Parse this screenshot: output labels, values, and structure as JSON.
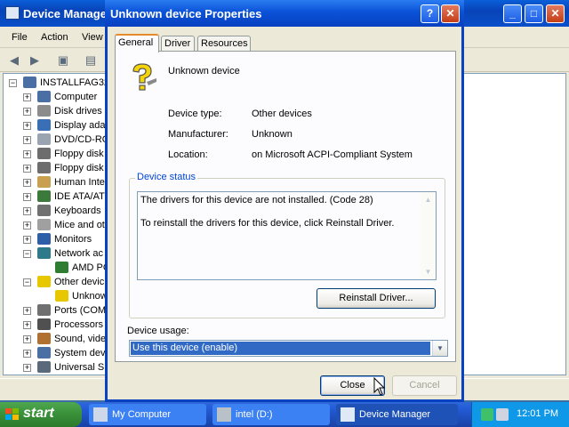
{
  "device_manager": {
    "title": "Device Manager",
    "menu": [
      "File",
      "Action",
      "View"
    ],
    "tree": [
      {
        "label": "INSTALLFAG32",
        "level": 0,
        "expander": "minus",
        "icon": "computer-icon"
      },
      {
        "label": "Computer",
        "level": 1,
        "expander": "plus",
        "icon": "computer-icon"
      },
      {
        "label": "Disk drives",
        "level": 1,
        "expander": "plus",
        "icon": "disk-drive-icon"
      },
      {
        "label": "Display ada",
        "level": 1,
        "expander": "plus",
        "icon": "display-adapter-icon"
      },
      {
        "label": "DVD/CD-RO",
        "level": 1,
        "expander": "plus",
        "icon": "cdrom-icon"
      },
      {
        "label": "Floppy disk",
        "level": 1,
        "expander": "plus",
        "icon": "floppy-icon"
      },
      {
        "label": "Floppy disk",
        "level": 1,
        "expander": "plus",
        "icon": "floppy-drive-icon"
      },
      {
        "label": "Human Inte",
        "level": 1,
        "expander": "plus",
        "icon": "hid-icon"
      },
      {
        "label": "IDE ATA/AT",
        "level": 1,
        "expander": "plus",
        "icon": "ide-icon"
      },
      {
        "label": "Keyboards",
        "level": 1,
        "expander": "plus",
        "icon": "keyboard-icon"
      },
      {
        "label": "Mice and ot",
        "level": 1,
        "expander": "plus",
        "icon": "mouse-icon"
      },
      {
        "label": "Monitors",
        "level": 1,
        "expander": "plus",
        "icon": "monitor-icon"
      },
      {
        "label": "Network ac",
        "level": 1,
        "expander": "minus",
        "icon": "network-icon"
      },
      {
        "label": "AMD PC",
        "level": 2,
        "expander": "none",
        "icon": "network-card-icon"
      },
      {
        "label": "Other devic",
        "level": 1,
        "expander": "minus",
        "icon": "question-icon"
      },
      {
        "label": "Unknow",
        "level": 2,
        "expander": "none",
        "icon": "warning-question-icon"
      },
      {
        "label": "Ports (COM",
        "level": 1,
        "expander": "plus",
        "icon": "port-icon"
      },
      {
        "label": "Processors",
        "level": 1,
        "expander": "plus",
        "icon": "processor-icon"
      },
      {
        "label": "Sound, vide",
        "level": 1,
        "expander": "plus",
        "icon": "sound-icon"
      },
      {
        "label": "System dev",
        "level": 1,
        "expander": "plus",
        "icon": "system-device-icon"
      },
      {
        "label": "Universal S",
        "level": 1,
        "expander": "plus",
        "icon": "usb-icon"
      }
    ]
  },
  "dialog": {
    "title": "Unknown device Properties",
    "tabs": [
      "General",
      "Driver",
      "Resources"
    ],
    "active_tab": "General",
    "device_name": "Unknown device",
    "properties": [
      {
        "label": "Device type:",
        "value": "Other devices"
      },
      {
        "label": "Manufacturer:",
        "value": "Unknown"
      },
      {
        "label": "Location:",
        "value": "on Microsoft ACPI-Compliant System"
      }
    ],
    "status_group_label": "Device status",
    "status_lines": [
      "The drivers for this device are not installed. (Code 28)",
      "To reinstall the drivers for this device, click Reinstall Driver."
    ],
    "reinstall_button": "Reinstall Driver...",
    "usage_label": "Device usage:",
    "usage_value": "Use this device (enable)",
    "close_button": "Close",
    "cancel_button": "Cancel"
  },
  "taskbar": {
    "start_label": "start",
    "tasks": [
      {
        "label": "My Computer",
        "icon": "my-computer-icon",
        "active": false
      },
      {
        "label": "intel (D:)",
        "icon": "drive-icon",
        "active": false
      },
      {
        "label": "Device Manager",
        "icon": "device-manager-icon",
        "active": true
      }
    ],
    "clock": "12:01 PM"
  },
  "colors": {
    "title_blue": "#0a52d8",
    "selection_blue": "#316ac5",
    "group_label_blue": "#0046d5",
    "start_green": "#3c943c",
    "tab_highlight": "#e68b2c"
  }
}
